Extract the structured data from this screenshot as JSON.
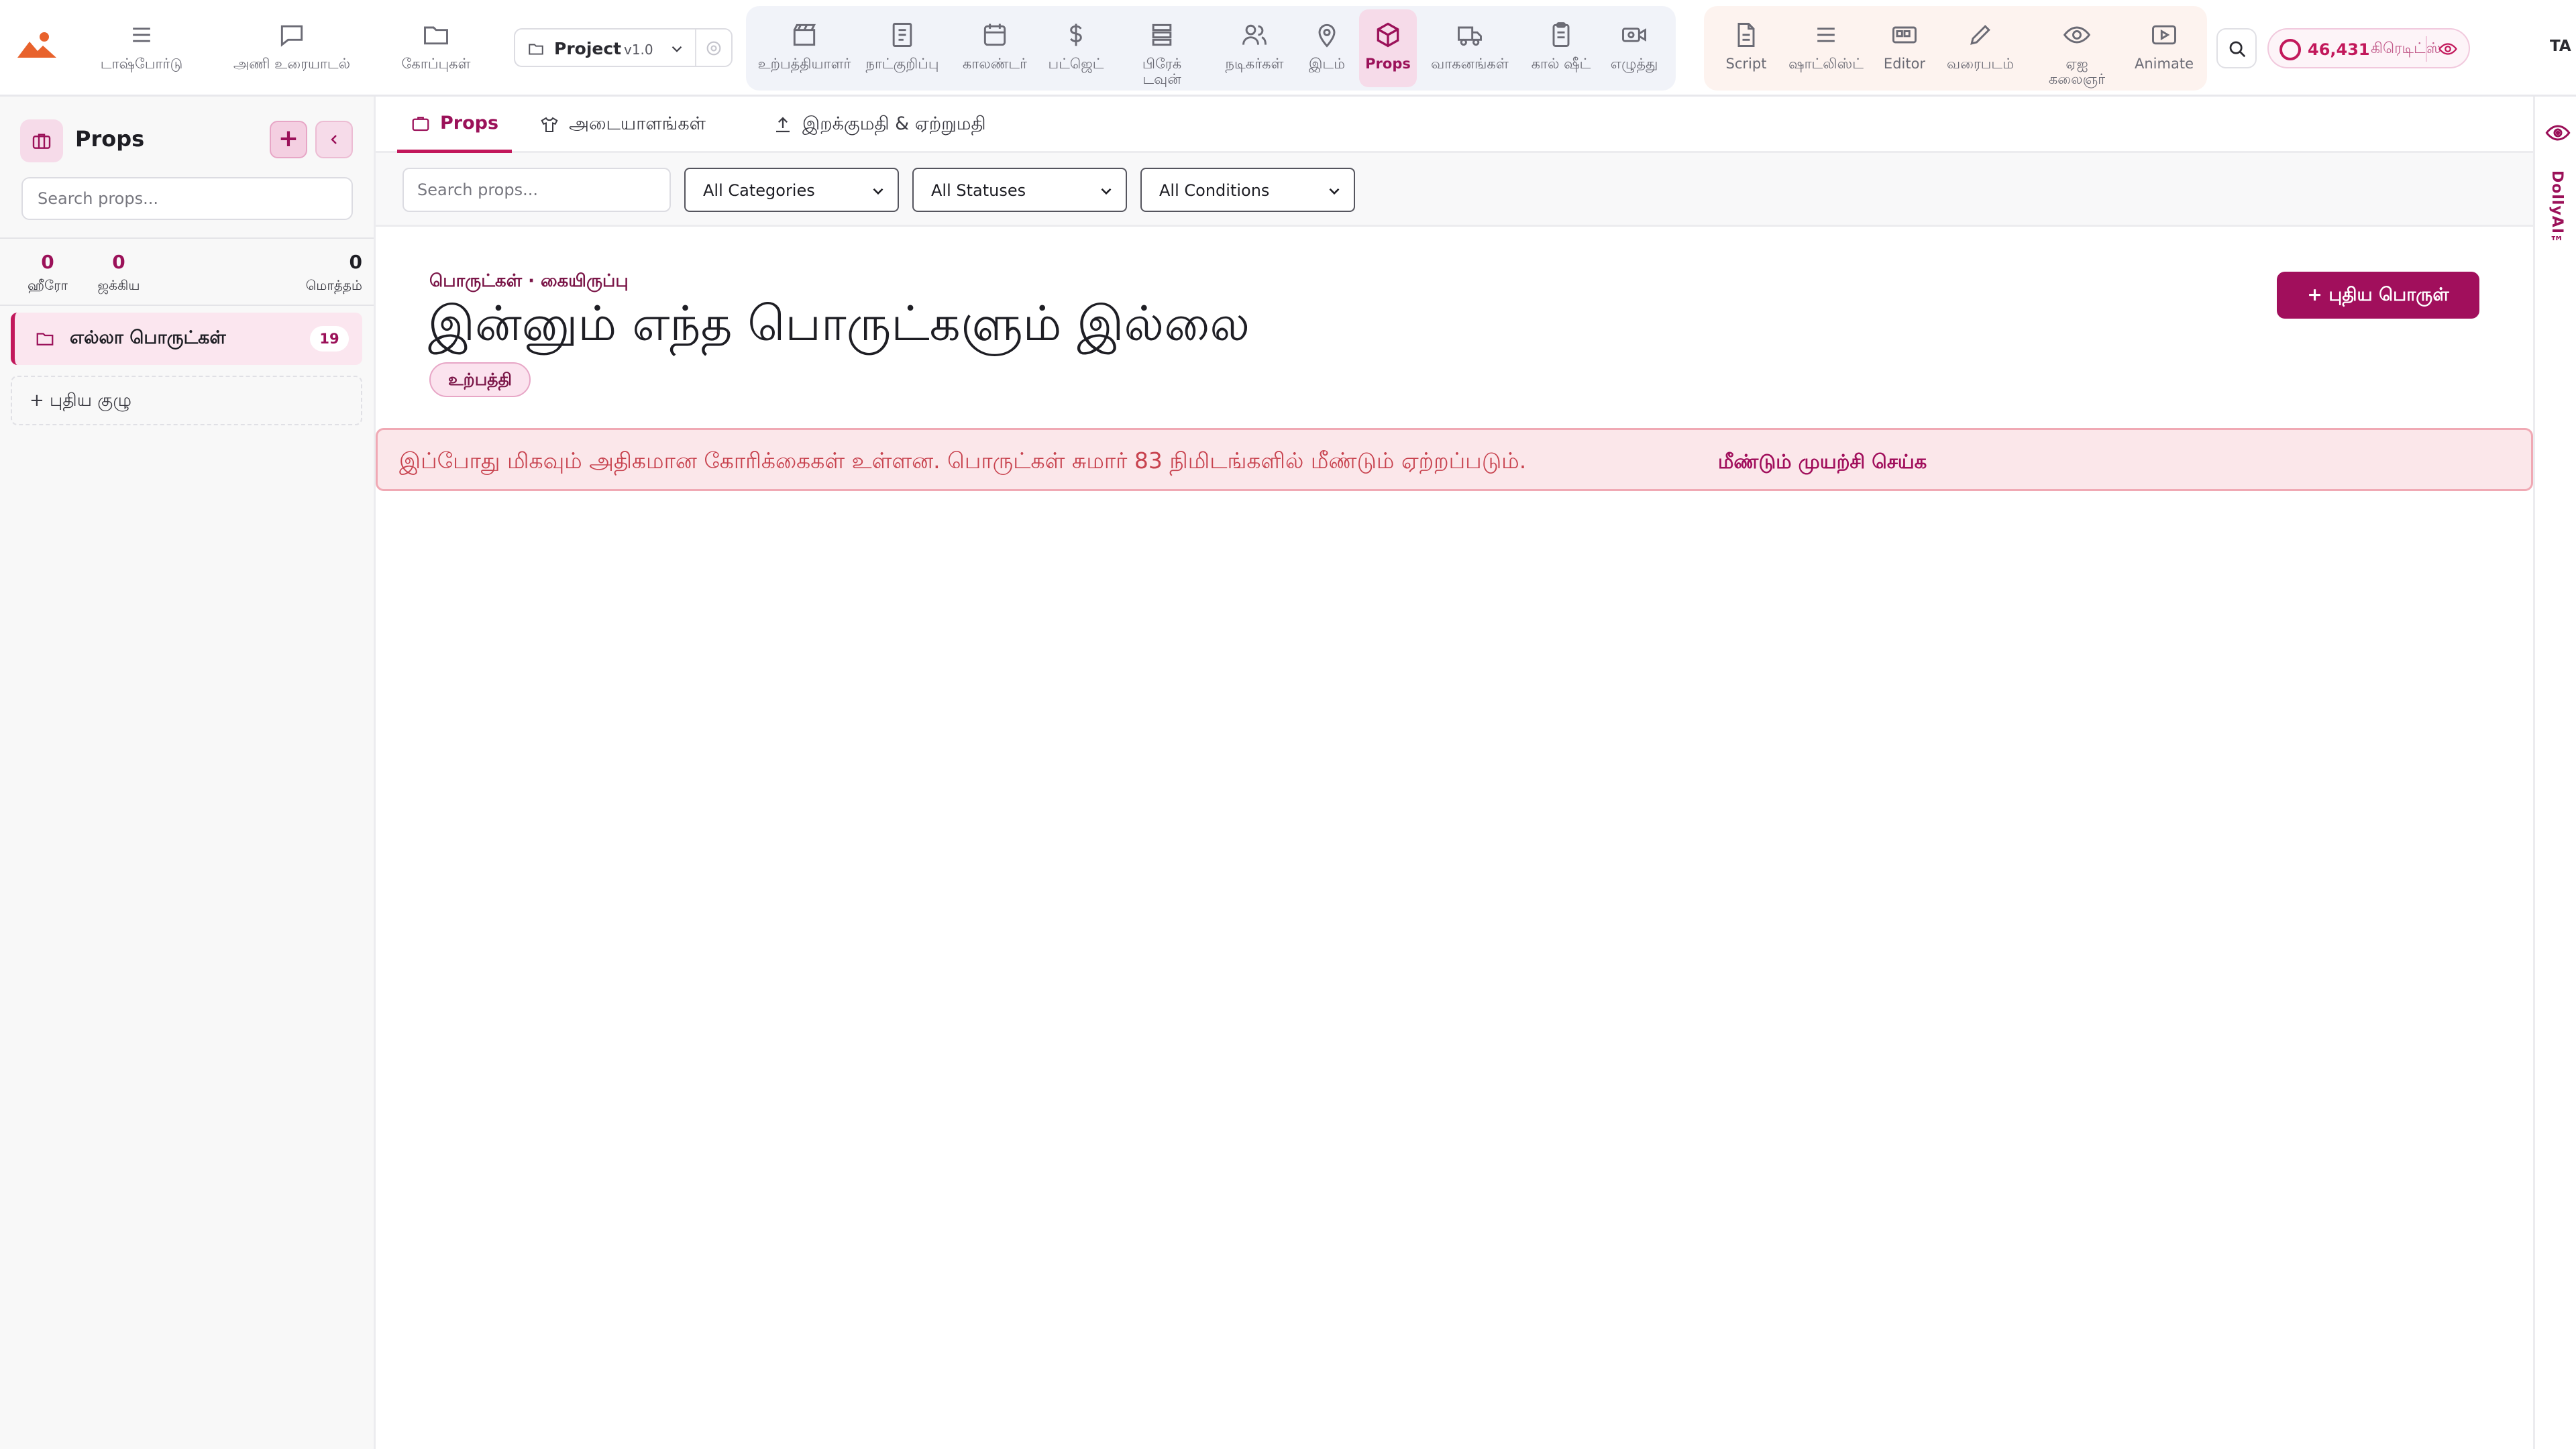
{
  "app": {
    "brand_color": "#a10f5c",
    "accent_color": "#c2185b"
  },
  "topnav": {
    "left": [
      {
        "label": "டாஷ்போர்டு",
        "icon": "menu-icon"
      },
      {
        "label": "அணி உரையாடல்",
        "icon": "chat-icon"
      },
      {
        "label": "கோப்புகள்",
        "icon": "folder-icon"
      }
    ],
    "project": {
      "name": "Project",
      "version": "v1.0"
    },
    "production": [
      {
        "label": "உற்பத்தியாளர்",
        "icon": "clapper-icon"
      },
      {
        "label": "நாட்குறிப்பு",
        "icon": "notebook-icon"
      },
      {
        "label": "காலண்டர்",
        "icon": "calendar-icon"
      },
      {
        "label": "பட்ஜெட்",
        "icon": "dollar-icon"
      },
      {
        "label": "பிரேக் டவுன்",
        "icon": "stack-icon"
      },
      {
        "label": "நடிகர்கள்",
        "icon": "people-icon"
      },
      {
        "label": "இடம்",
        "icon": "pin-icon"
      },
      {
        "label": "Props",
        "icon": "cube-icon"
      },
      {
        "label": "வாகனங்கள்",
        "icon": "truck-icon"
      },
      {
        "label": "கால் ஷீட்",
        "icon": "clipboard-icon"
      },
      {
        "label": "எழுத்து",
        "icon": "camera-icon"
      }
    ],
    "post": [
      {
        "label": "Script",
        "icon": "document-icon"
      },
      {
        "label": "ஷாட்லிஸ்ட்",
        "icon": "list-icon"
      },
      {
        "label": "Editor",
        "icon": "editor-icon"
      },
      {
        "label": "வரைபடம்",
        "icon": "pencil-icon"
      },
      {
        "label": "ஏஐ கலைஞர்",
        "icon": "eye-icon"
      },
      {
        "label": "Animate",
        "icon": "play-icon"
      }
    ],
    "credits": {
      "count": "46,431",
      "label": "கிரெடிட்ஸ்"
    },
    "language": "TA"
  },
  "sidebar": {
    "title": "Props",
    "search_placeholder": "Search props...",
    "stats": [
      {
        "value": "0",
        "label": "ஹீரோ"
      },
      {
        "value": "0",
        "label": "ஜக்கிய"
      },
      {
        "value": "0",
        "label": "மொத்தம்"
      }
    ],
    "group": {
      "name": "எல்லா பொருட்கள்",
      "count": "19"
    },
    "new_group": "+  புதிய குழு"
  },
  "tabs": [
    {
      "label": "Props"
    },
    {
      "label": "அடையாளங்கள்"
    },
    {
      "label": "இறக்குமதி & ஏற்றுமதி"
    }
  ],
  "filters": {
    "search_placeholder": "Search props...",
    "category": "All Categories",
    "status": "All Statuses",
    "condition": "All Conditions"
  },
  "hero": {
    "breadcrumb": "பொருட்கள் · கையிருப்பு",
    "title": "இன்னும் எந்த பொருட்களும் இல்லை",
    "chip": "உற்பத்தி",
    "new_button": "+ புதிய பொருள்"
  },
  "alert": {
    "message": "இப்போது மிகவும் அதிகமான கோரிக்கைகள் உள்ளன. பொருட்கள் சுமார் 83 நிமிடங்களில் மீண்டும் ஏற்றப்படும்.",
    "retry": "மீண்டும் முயற்சி செய்க"
  },
  "rail": {
    "label": "DollyAI™"
  }
}
